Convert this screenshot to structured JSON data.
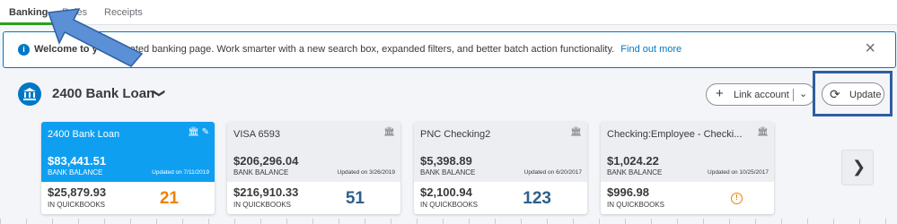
{
  "tabs": [
    {
      "label": "Banking",
      "active": true
    },
    {
      "label": "Rules",
      "active": false
    },
    {
      "label": "Receipts",
      "active": false
    }
  ],
  "banner": {
    "icon": "info-icon",
    "bold_text": "Welcome to y",
    "text": "ated banking page. Work smarter with a new search box, expanded filters, and better batch action functionality.",
    "link": "Find out more",
    "close": "×"
  },
  "account": {
    "name": "2400 Bank Loan",
    "chevron": "❯"
  },
  "buttons": {
    "link_account": "Link account",
    "update": "Update"
  },
  "cards": [
    {
      "name": "2400 Bank Loan",
      "bank_balance": "$83,441.51",
      "bank_balance_label": "BANK BALANCE",
      "updated": "Updated on 7/11/2019",
      "qb_balance": "$25,879.93",
      "qb_label": "IN QUICKBOOKS",
      "count": "21"
    },
    {
      "name": "VISA 6593",
      "bank_balance": "$206,296.04",
      "bank_balance_label": "BANK BALANCE",
      "updated": "Updated on 3/26/2019",
      "qb_balance": "$216,910.33",
      "qb_label": "IN QUICKBOOKS",
      "count": "51"
    },
    {
      "name": "PNC Checking2",
      "bank_balance": "$5,398.89",
      "bank_balance_label": "BANK BALANCE",
      "updated": "Updated on 6/20/2017",
      "qb_balance": "$2,100.94",
      "qb_label": "IN QUICKBOOKS",
      "count": "123"
    },
    {
      "name": "Checking:Employee - Checki...",
      "bank_balance": "$1,024.22",
      "bank_balance_label": "BANK BALANCE",
      "updated": "Updated on 10/25/2017",
      "qb_balance": "$996.98",
      "qb_label": "IN QUICKBOOKS",
      "warning": "!"
    }
  ],
  "colors": {
    "accent_blue": "#0077c5",
    "active_card": "#0f9ff1",
    "tab_underline": "#2ca01c",
    "count_orange": "#ef8200",
    "annotation": "#2e5f9e"
  }
}
